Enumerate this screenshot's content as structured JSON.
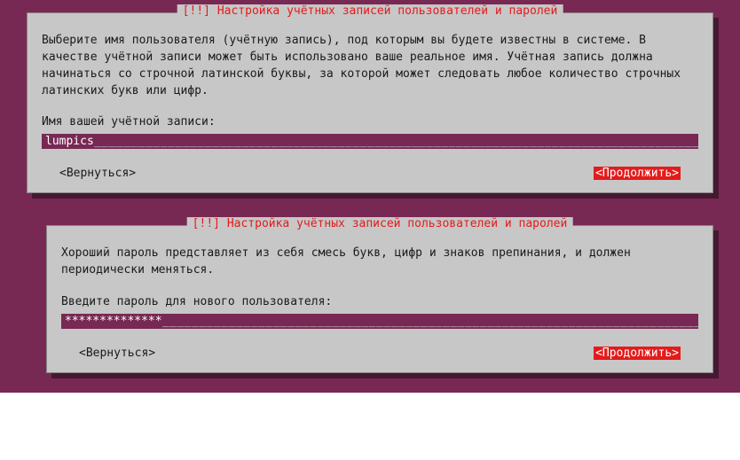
{
  "dialog1": {
    "title": "[!!] Настройка учётных записей пользователей и паролей",
    "instructions": "Выберите имя пользователя (учётную запись), под которым вы будете известны в системе. В качестве учётной записи может быть использовано ваше реальное имя. Учётная запись должна начинаться со строчной латинской буквы, за которой может следовать любое количество строчных латинских букв или цифр.",
    "prompt": "Имя вашей учётной записи:",
    "input_value": "lumpics",
    "back_label": "<Вернуться>",
    "continue_label": "<Продолжить>"
  },
  "dialog2": {
    "title": "[!!] Настройка учётных записей пользователей и паролей",
    "instructions": "Хороший пароль представляет из себя смесь букв, цифр и знаков препинания, и должен периодически меняться.",
    "prompt": "Введите пароль для нового пользователя:",
    "input_value": "**************",
    "back_label": "<Вернуться>",
    "continue_label": "<Продолжить>"
  }
}
